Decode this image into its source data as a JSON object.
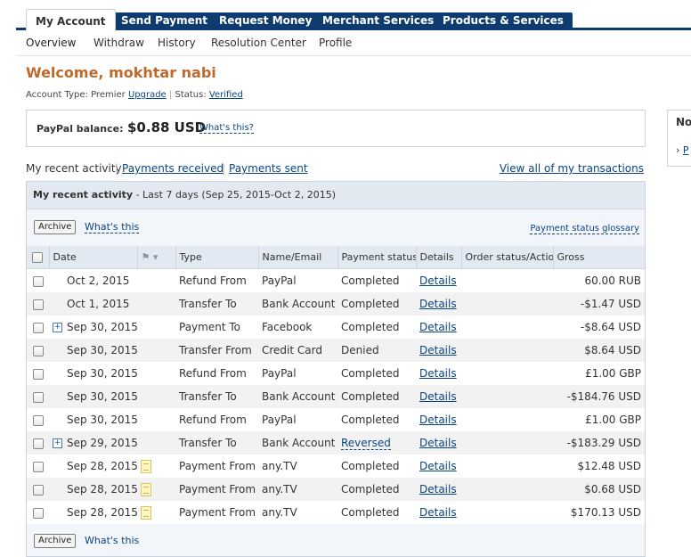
{
  "tabs": [
    {
      "label": "My Account",
      "active": true
    },
    {
      "label": "Send Payment",
      "active": false
    },
    {
      "label": "Request Money",
      "active": false
    },
    {
      "label": "Merchant Services",
      "active": false
    },
    {
      "label": "Products & Services",
      "active": false
    }
  ],
  "subnav": [
    "Overview",
    "Withdraw",
    "History",
    "Resolution Center",
    "Profile"
  ],
  "welcome": "Welcome, mokhtar nabi",
  "account": {
    "type_label": "Account Type: Premier",
    "upgrade": "Upgrade",
    "status_label": "Status:",
    "status_value": "Verified"
  },
  "balance": {
    "label": "PayPal balance:",
    "amount": "$0.88 USD",
    "whats_this": "What's this?"
  },
  "sidebox": {
    "title": "No",
    "link": "P"
  },
  "filters": {
    "recent": "My recent activity",
    "received": "Payments received",
    "sent": "Payments sent",
    "view_all": "View all of my transactions"
  },
  "panel": {
    "title": "My recent activity",
    "range": " - Last 7 days (Sep 25, 2015-Oct 2, 2015)",
    "archive": "Archive",
    "whats_this": "What's this",
    "glossary": "Payment status glossary"
  },
  "columns": [
    "Date",
    "Type",
    "Name/Email",
    "Payment status",
    "Details",
    "Order status/Actions",
    "Gross"
  ],
  "rows": [
    {
      "date": "Oct 2, 2015",
      "type": "Refund From",
      "name": "PayPal",
      "status": "Completed",
      "details": "Details",
      "gross": "60.00 RUB",
      "expand": false,
      "note": false
    },
    {
      "date": "Oct 1, 2015",
      "type": "Transfer To",
      "name": "Bank Account",
      "status": "Completed",
      "details": "Details",
      "gross": "-$1.47 USD",
      "expand": false,
      "note": false
    },
    {
      "date": "Sep 30, 2015",
      "type": "Payment To",
      "name": "Facebook",
      "status": "Completed",
      "details": "Details",
      "gross": "-$8.64 USD",
      "expand": true,
      "note": false
    },
    {
      "date": "Sep 30, 2015",
      "type": "Transfer From",
      "name": "Credit Card",
      "status": "Denied",
      "details": "Details",
      "gross": "$8.64 USD",
      "expand": false,
      "note": false
    },
    {
      "date": "Sep 30, 2015",
      "type": "Refund From",
      "name": "PayPal",
      "status": "Completed",
      "details": "Details",
      "gross": "£1.00 GBP",
      "expand": false,
      "note": false
    },
    {
      "date": "Sep 30, 2015",
      "type": "Transfer To",
      "name": "Bank Account",
      "status": "Completed",
      "details": "Details",
      "gross": "-$184.76 USD",
      "expand": false,
      "note": false
    },
    {
      "date": "Sep 30, 2015",
      "type": "Refund From",
      "name": "PayPal",
      "status": "Completed",
      "details": "Details",
      "gross": "£1.00 GBP",
      "expand": false,
      "note": false
    },
    {
      "date": "Sep 29, 2015",
      "type": "Transfer To",
      "name": "Bank Account",
      "status": "Reversed",
      "status_link": true,
      "details": "Details",
      "gross": "-$183.29 USD",
      "expand": true,
      "note": false
    },
    {
      "date": "Sep 28, 2015",
      "type": "Payment From",
      "name": "any.TV",
      "status": "Completed",
      "details": "Details",
      "gross": "$12.48 USD",
      "expand": false,
      "note": true
    },
    {
      "date": "Sep 28, 2015",
      "type": "Payment From",
      "name": "any.TV",
      "status": "Completed",
      "details": "Details",
      "gross": "$0.68 USD",
      "expand": false,
      "note": true
    },
    {
      "date": "Sep 28, 2015",
      "type": "Payment From",
      "name": "any.TV",
      "status": "Completed",
      "details": "Details",
      "gross": "$170.13 USD",
      "expand": false,
      "note": true
    }
  ],
  "footer": {
    "archive": "Archive",
    "whats_this": "What's this"
  }
}
